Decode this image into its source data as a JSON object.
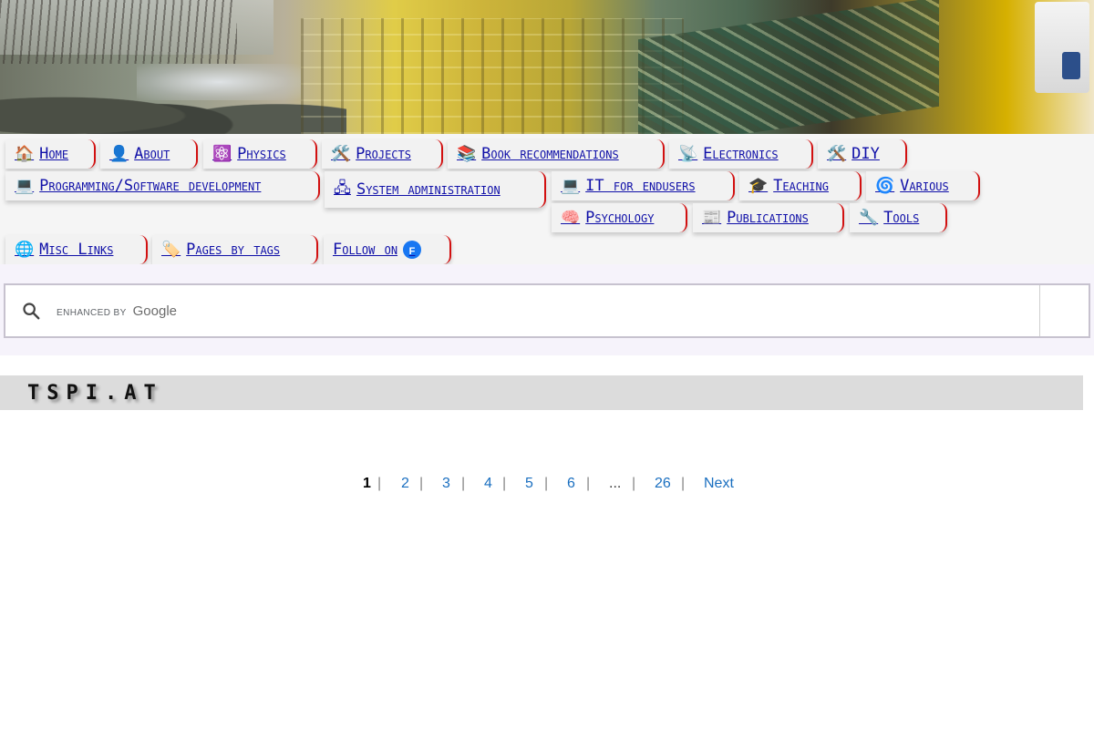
{
  "banner": {
    "alt": "header banner collage"
  },
  "menu": {
    "items": [
      {
        "icon": "🏠",
        "icon_name": "home-icon",
        "label": "Home"
      },
      {
        "icon": "👤",
        "icon_name": "person-icon",
        "label": "About"
      },
      {
        "icon": "⚛️",
        "icon_name": "atom-icon",
        "label": "Physics"
      },
      {
        "icon": "🛠️",
        "icon_name": "tools-icon",
        "label": "Projects"
      },
      {
        "icon": "📚",
        "icon_name": "books-icon",
        "label": "Book recommendations"
      },
      {
        "icon": "📡",
        "icon_name": "satellite-antenna-icon",
        "label": "Electronics"
      },
      {
        "icon": "🛠️",
        "icon_name": "tools-icon",
        "label": "DIY"
      },
      {
        "icon": "💻",
        "icon_name": "laptop-icon",
        "label": "Programming/Software development"
      },
      {
        "icon": "🖧",
        "icon_name": "network-icon",
        "label": "System administration"
      },
      {
        "icon": "💻",
        "icon_name": "laptop-icon",
        "label": "IT for endusers"
      },
      {
        "icon": "🎓",
        "icon_name": "graduation-cap-icon",
        "label": "Teaching"
      },
      {
        "icon": "🌀",
        "icon_name": "cyclone-icon",
        "label": "Various"
      },
      {
        "icon": "🧠",
        "icon_name": "brain-icon",
        "label": "Psychology"
      },
      {
        "icon": "📰",
        "icon_name": "newspaper-icon",
        "label": "Publications"
      },
      {
        "icon": "🔧",
        "icon_name": "wrench-icon",
        "label": "Tools"
      },
      {
        "icon": "🌐",
        "icon_name": "globe-icon",
        "label": "Misc Links"
      },
      {
        "icon": "🏷️",
        "icon_name": "tag-icon",
        "label": "Pages by tags"
      },
      {
        "icon": "f",
        "icon_name": "facebook-icon",
        "label": "Follow on"
      }
    ]
  },
  "search": {
    "enhanced_by": "enhanced by",
    "brand": "Google",
    "value": "",
    "placeholder": ""
  },
  "site": {
    "title": "TSPI.AT"
  },
  "pagination": {
    "current": "1",
    "pages": [
      "2",
      "3",
      "4",
      "5",
      "6"
    ],
    "ellipsis": "...",
    "last": "26",
    "next": "Next",
    "separator": "|"
  },
  "colors": {
    "link": "#1010a8",
    "accent_border": "#d21010",
    "page_link": "#1a6fc0"
  }
}
